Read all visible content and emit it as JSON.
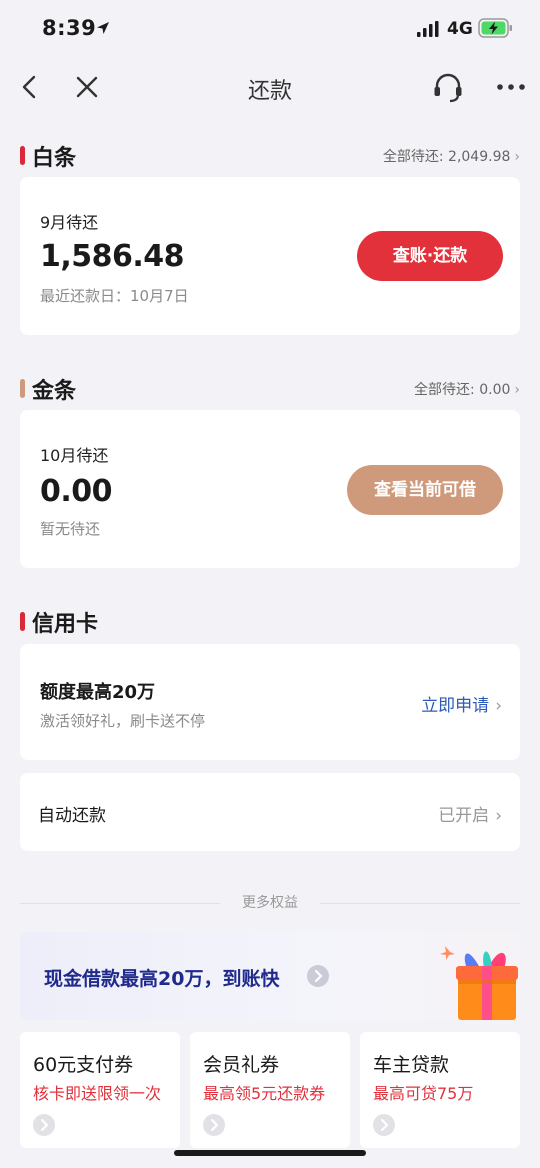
{
  "status_bar": {
    "time": "8:39",
    "network": "4G"
  },
  "nav": {
    "title": "还款"
  },
  "baitiao": {
    "title": "白条",
    "total_label": "全部待还: 2,049.98",
    "accent": "#d9283a",
    "month_label": "9月待还",
    "amount": "1,586.48",
    "due": "最近还款日：10月7日",
    "button": "查账·还款",
    "button_color": "#e2313b"
  },
  "jintiao": {
    "title": "金条",
    "total_label": "全部待还: 0.00",
    "accent": "#cf9a7c",
    "month_label": "10月待还",
    "amount": "0.00",
    "status": "暂无待还",
    "button": "查看当前可借",
    "button_color": "#cf9a7c"
  },
  "credit_card": {
    "title": "信用卡",
    "accent": "#d9283a",
    "offer_title": "额度最高20万",
    "offer_sub": "激活领好礼，刷卡送不停",
    "apply": "立即申请"
  },
  "auto_repay": {
    "label": "自动还款",
    "status": "已开启"
  },
  "more_benefits": "更多权益",
  "banner": {
    "text": "现金借款最高20万，到账快"
  },
  "tiles": [
    {
      "title": "60元支付券",
      "sub": "核卡即送限领一次"
    },
    {
      "title": "会员礼券",
      "sub": "最高领5元还款券"
    },
    {
      "title": "车主贷款",
      "sub": "最高可贷75万"
    }
  ]
}
